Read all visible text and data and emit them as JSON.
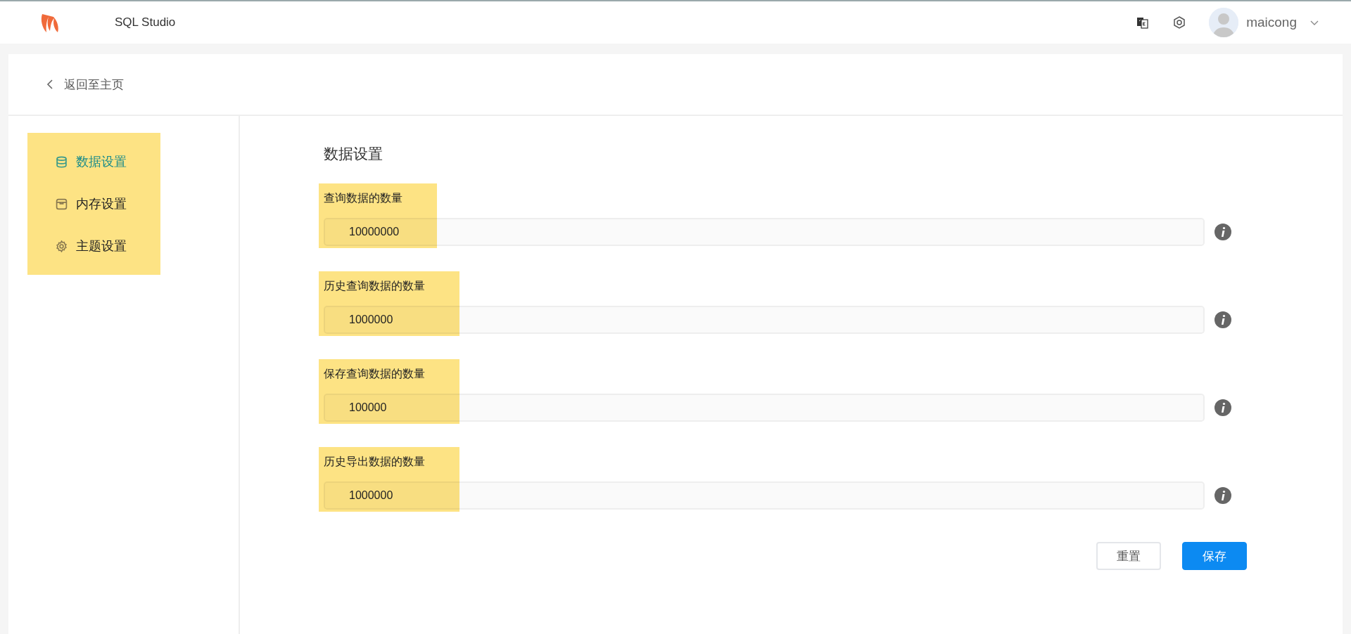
{
  "header": {
    "app_name": "SQL Studio",
    "username": "maicong"
  },
  "back_link": "返回至主页",
  "sidebar": {
    "highlighted": true,
    "items": [
      {
        "label": "数据设置",
        "selected": true
      },
      {
        "label": "内存设置",
        "selected": false
      },
      {
        "label": "主题设置",
        "selected": false
      }
    ]
  },
  "content": {
    "title": "数据设置",
    "fields": [
      {
        "label": "查询数据的数量",
        "value": "10000000",
        "highlighted": true
      },
      {
        "label": "历史查询数据的数量",
        "value": "1000000",
        "highlighted": true
      },
      {
        "label": "保存查询数据的数量",
        "value": "100000",
        "highlighted": true
      },
      {
        "label": "历史导出数据的数量",
        "value": "1000000",
        "highlighted": true
      }
    ],
    "buttons": [
      {
        "label": "重置",
        "kind": "default"
      },
      {
        "label": "保存",
        "kind": "primary"
      }
    ]
  }
}
